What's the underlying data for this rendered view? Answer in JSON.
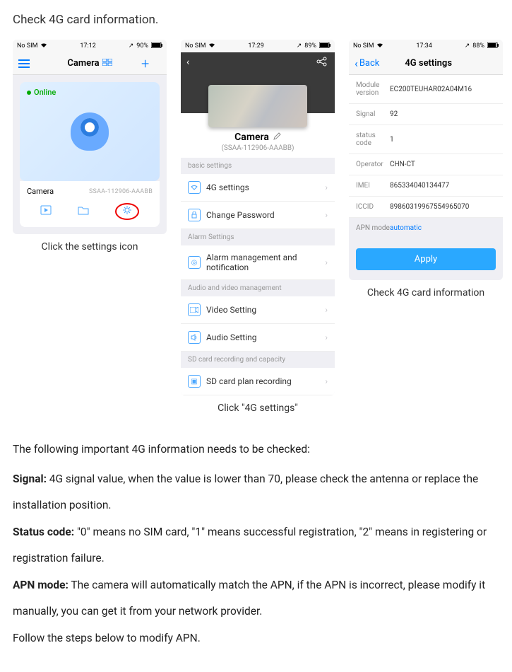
{
  "title": "Check 4G card information.",
  "phones": {
    "p1": {
      "status": {
        "left": "No SIM",
        "time": "17:12",
        "right": "90%"
      },
      "nav": {
        "left_icon": "list-icon",
        "title": "Camera",
        "title_icon": "grid-icon",
        "right_icon": "plus-icon",
        "right_glyph": "+"
      },
      "card": {
        "online": "Online",
        "name": "Camera",
        "serial": "SSAA-112906-AAABB"
      },
      "caption": "Click the settings icon"
    },
    "p2": {
      "status": {
        "left": "No SIM",
        "time": "17:29",
        "right": "89%"
      },
      "header": {
        "cam_name": "Camera",
        "serial": "(SSAA-112906-AAABB)"
      },
      "sections": {
        "basic": {
          "header": "basic settings",
          "items": [
            {
              "icon": "wifi-icon",
              "label": "4G settings"
            },
            {
              "icon": "lock-icon",
              "label": "Change Password"
            }
          ]
        },
        "alarm": {
          "header": "Alarm Settings",
          "items": [
            {
              "icon": "bell-icon",
              "label": "Alarm management and notification"
            }
          ]
        },
        "av": {
          "header": "Audio and video management",
          "items": [
            {
              "icon": "video-icon",
              "label": "Video Setting"
            },
            {
              "icon": "audio-icon",
              "label": "Audio Setting"
            }
          ]
        },
        "sd": {
          "header": "SD card recording and capacity",
          "items": [
            {
              "icon": "rec-icon",
              "label": "SD card plan recording"
            }
          ]
        }
      },
      "caption": "Click \"4G settings\""
    },
    "p3": {
      "status": {
        "left": "No SIM",
        "time": "17:34",
        "right": "88%"
      },
      "nav": {
        "back": "Back",
        "title": "4G settings"
      },
      "kv": [
        {
          "k": "Module version",
          "v": "EC200TEUHAR02A04M16"
        },
        {
          "k": "Signal",
          "v": "92"
        },
        {
          "k": "status code",
          "v": "1"
        },
        {
          "k": "Operator",
          "v": "CHN-CT"
        },
        {
          "k": "IMEI",
          "v": "865334040134477"
        },
        {
          "k": "ICCID",
          "v": "89860319967554965070"
        }
      ],
      "apn": {
        "k": "APN mode",
        "v": "automatic"
      },
      "apply": "Apply",
      "caption": "Check 4G card information"
    }
  },
  "body": {
    "lead": "The following important 4G information needs to be checked:",
    "signal_k": "Signal:",
    "signal_v": " 4G signal value, when the value is lower than 70, please check the antenna or replace the installation position.",
    "status_k": "Status code:",
    "status_v": " \"0\" means no SIM card, \"1\" means successful registration, \"2\" means in registering or registration failure.",
    "apn_k": "APN mode:",
    "apn_v": " The camera will automatically match the APN, if the APN is incorrect, please modify it manually, you can get it from your network provider.",
    "follow": "Follow the steps below to modify APN."
  }
}
